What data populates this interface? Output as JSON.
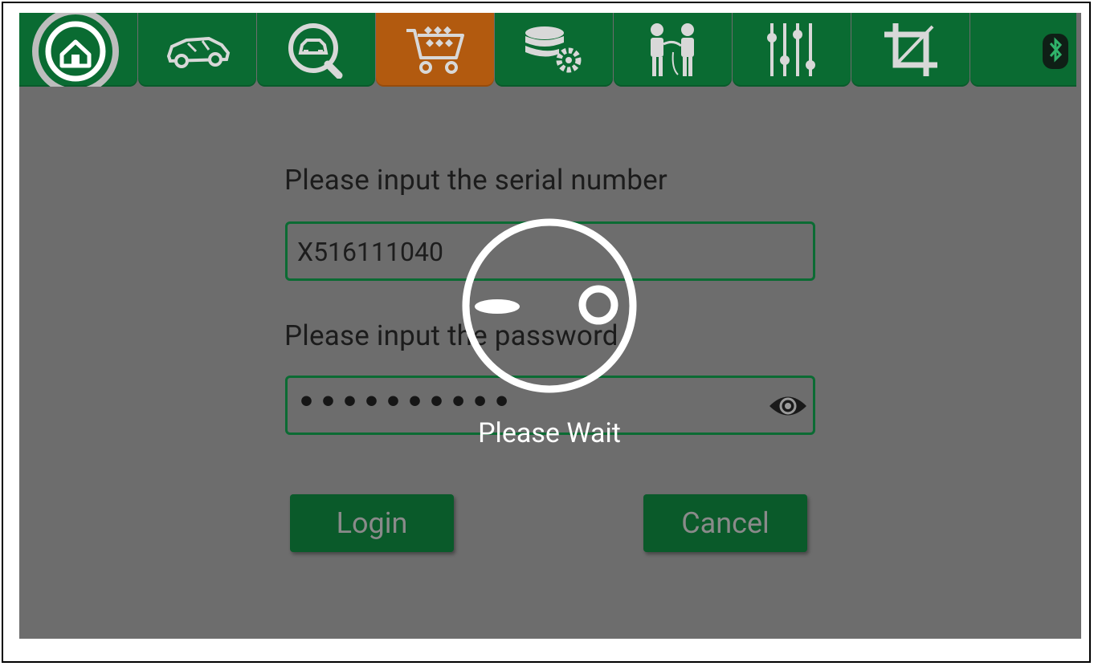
{
  "toolbar": {
    "tabs": [
      {
        "name": "home-icon",
        "active": false
      },
      {
        "name": "car-icon",
        "active": false
      },
      {
        "name": "car-search-icon",
        "active": false
      },
      {
        "name": "shopping-cart-icon",
        "active": true
      },
      {
        "name": "database-settings-icon",
        "active": false
      },
      {
        "name": "technicians-icon",
        "active": false
      },
      {
        "name": "sliders-icon",
        "active": false
      },
      {
        "name": "crop-icon",
        "active": false
      },
      {
        "name": "bluetooth-icon",
        "active": false
      }
    ],
    "colors": {
      "tab": "#0a6b32",
      "active_tab": "#b25a0f"
    }
  },
  "login": {
    "serial_label": "Please input the serial number",
    "serial_value": "X516111040",
    "password_label": "Please input the password",
    "password_value": "••••••••••",
    "login_button": "Login",
    "cancel_button": "Cancel"
  },
  "overlay": {
    "wait_text": "Please Wait"
  },
  "colors": {
    "background": "#6d6d6d",
    "accent_green": "#0b6b33"
  }
}
